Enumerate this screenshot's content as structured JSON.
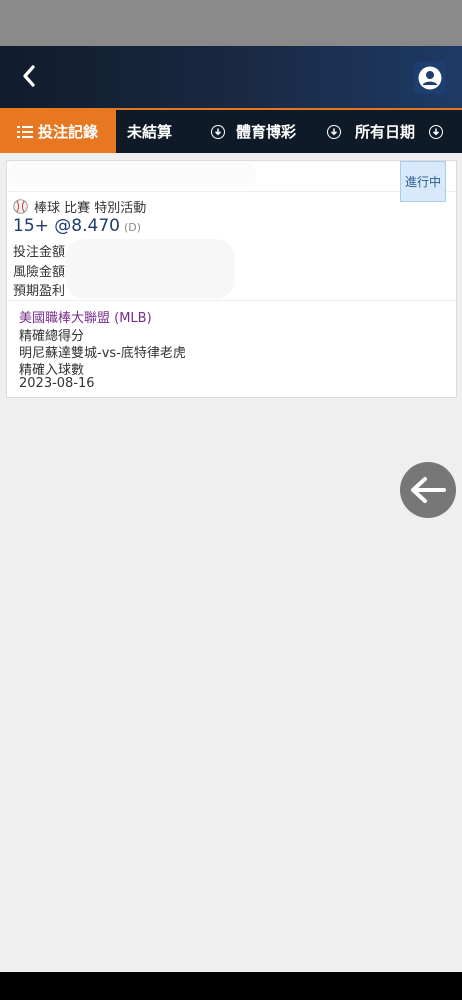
{
  "tabs": [
    {
      "label": "投注記錄"
    },
    {
      "label": "未結算"
    },
    {
      "label": "體育博彩"
    },
    {
      "label": "所有日期"
    }
  ],
  "colors": {
    "accent": "#e87722",
    "header_dark": "#0f1a28",
    "league": "#7a2d8c",
    "odds": "#1e3c6e"
  },
  "bet": {
    "status": "進行中",
    "sport_line": "棒球 比賽 特別活動",
    "selection": "15+ @8.470",
    "odds_code": "(D)",
    "stake_label": "投注金額",
    "risk_label": "風險金額",
    "payout_label": "預期盈利",
    "league": "美國職棒大聯盟 (MLB)",
    "market": "精確總得分",
    "match": "明尼蘇達雙城-vs-底特律老虎",
    "bet_type": "精確入球數",
    "date": "2023-08-16"
  },
  "icons": {
    "back": "chevron-left-icon",
    "profile": "user-circle-icon",
    "list": "list-icon",
    "download": "download-circle-icon",
    "baseball": "baseball-icon",
    "fab": "arrow-left-icon"
  }
}
